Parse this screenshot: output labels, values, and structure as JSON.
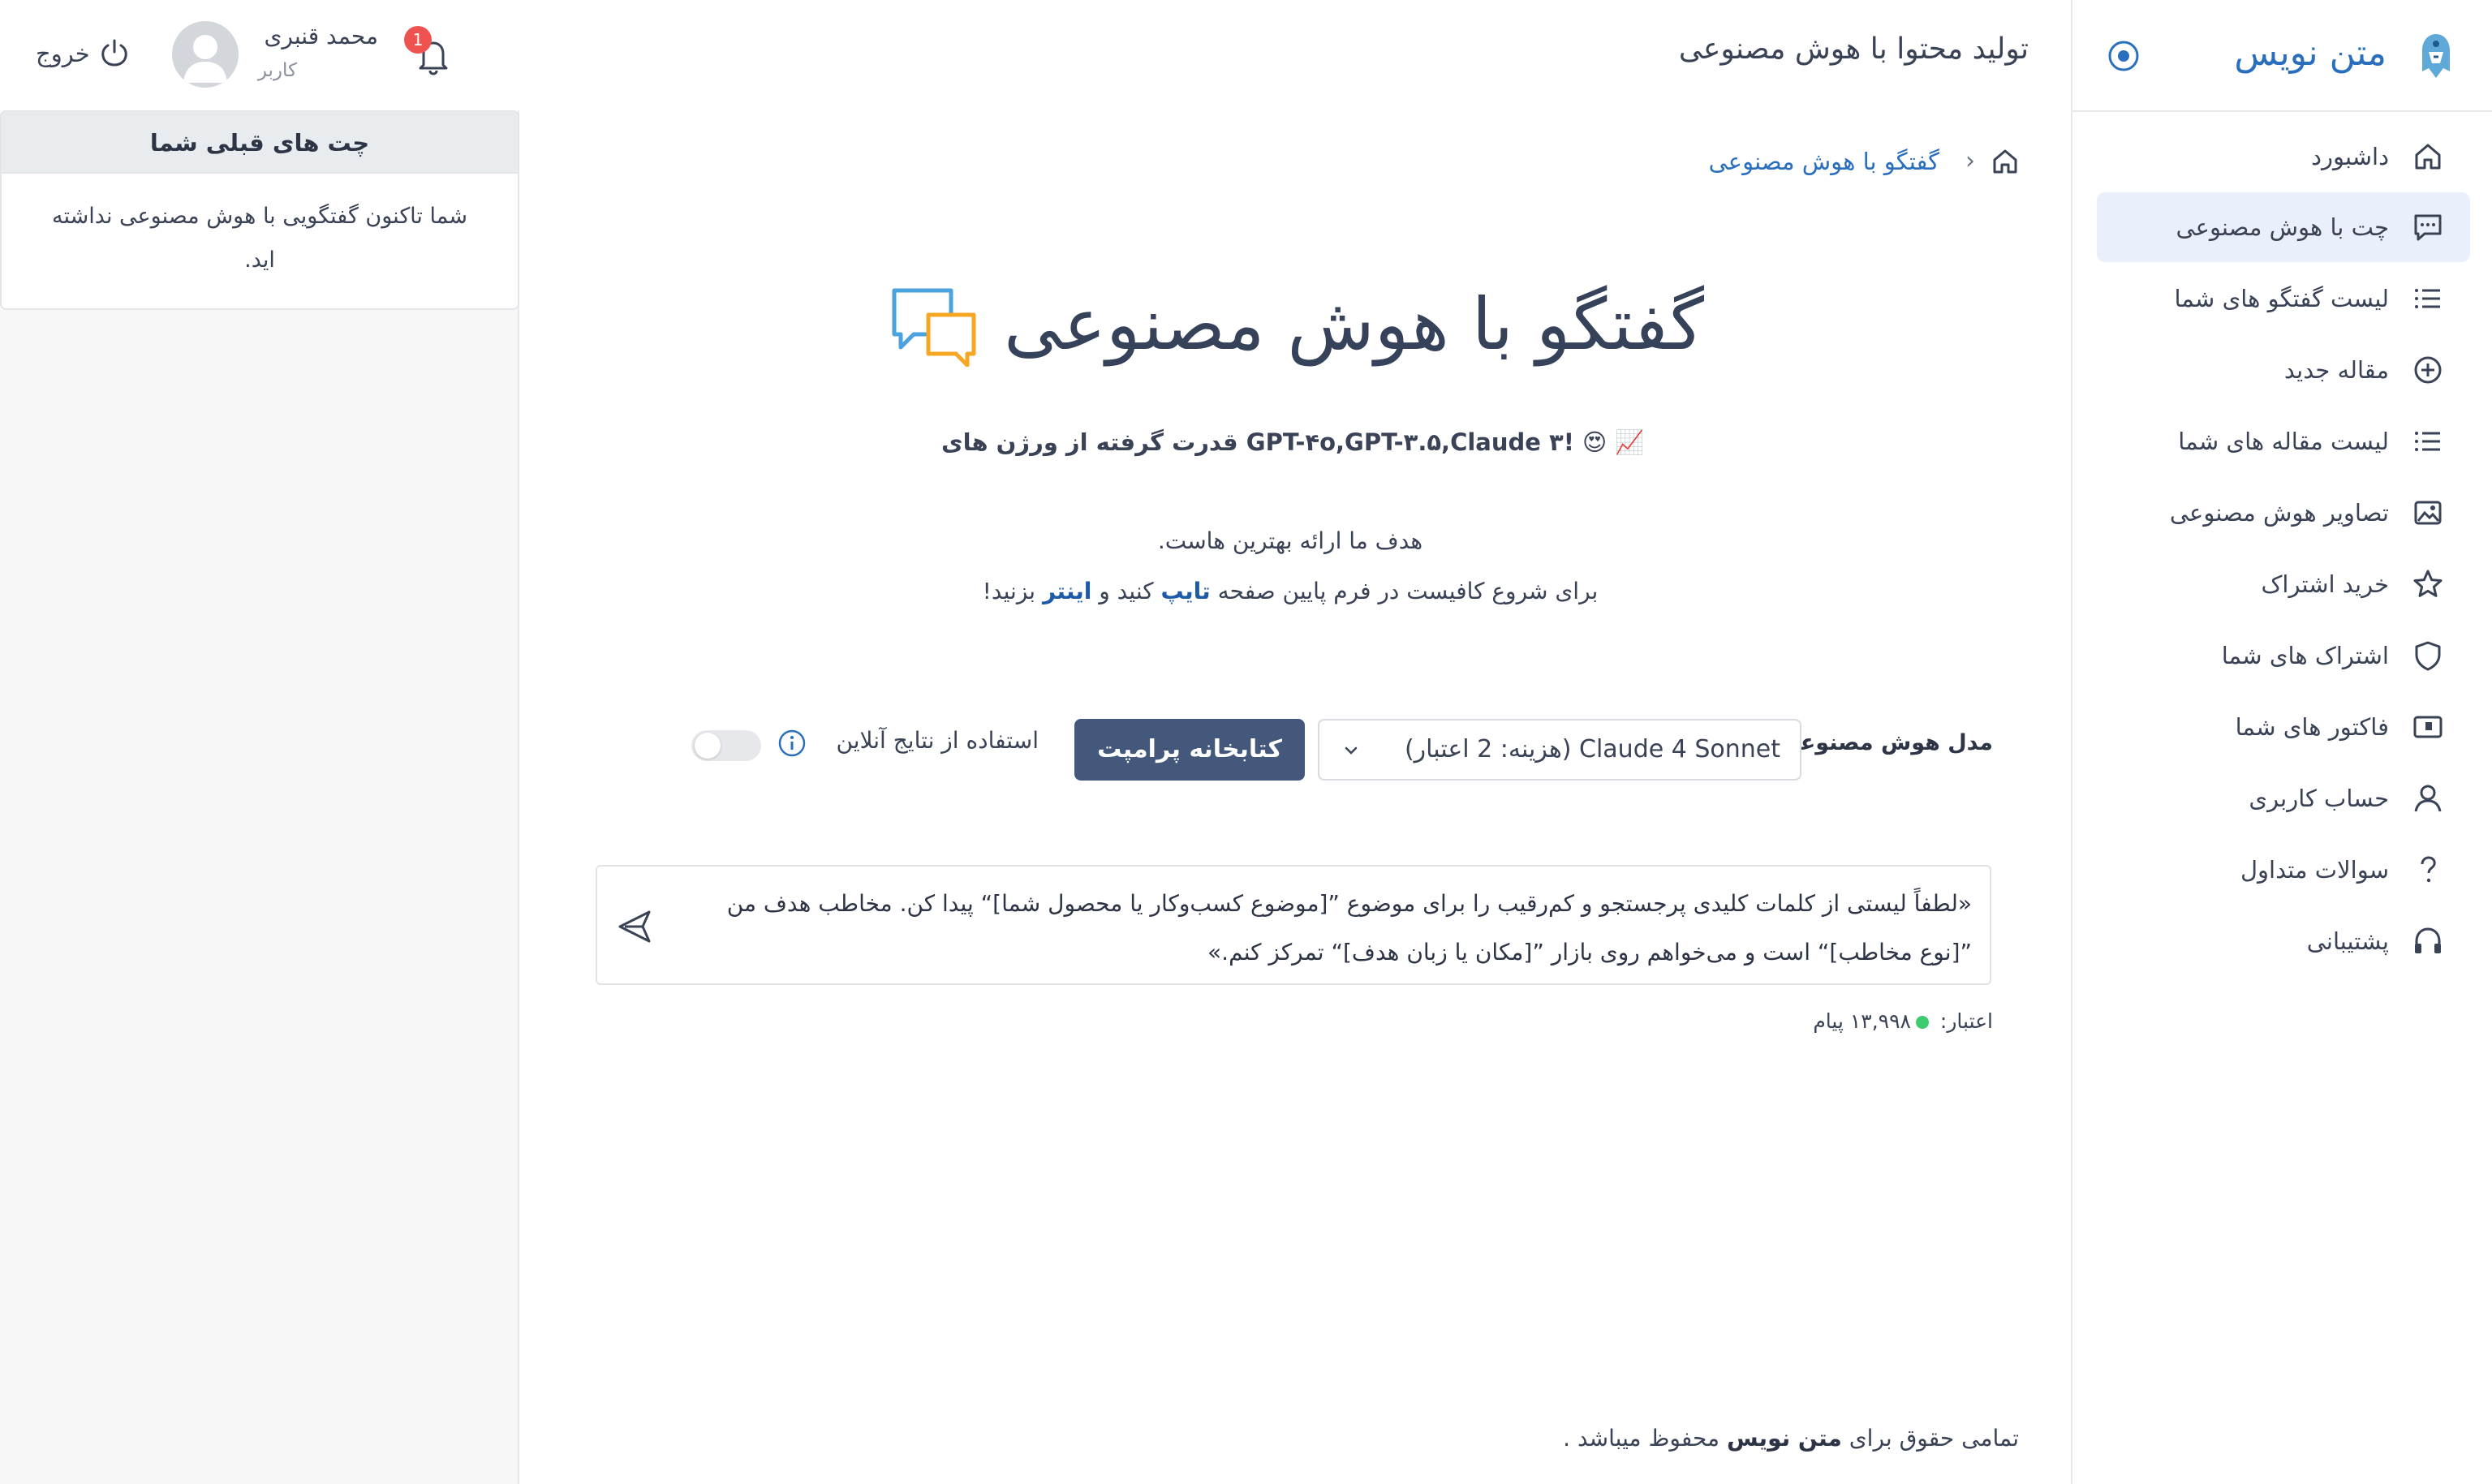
{
  "sidebar": {
    "brand": "متن نویس",
    "items": [
      {
        "label": "داشبورد",
        "icon": "home-icon",
        "active": false
      },
      {
        "label": "چت با هوش مصنوعی",
        "icon": "chat-icon",
        "active": true
      },
      {
        "label": "لیست گفتگو های شما",
        "icon": "list-icon",
        "active": false
      },
      {
        "label": "مقاله جدید",
        "icon": "plus-circle-icon",
        "active": false
      },
      {
        "label": "لیست مقاله های شما",
        "icon": "list-icon",
        "active": false
      },
      {
        "label": "تصاویر هوش مصنوعی",
        "icon": "image-icon",
        "active": false
      },
      {
        "label": "خرید اشتراک",
        "icon": "star-icon",
        "active": false
      },
      {
        "label": "اشتراک های شما",
        "icon": "shield-icon",
        "active": false
      },
      {
        "label": "فاکتور های شما",
        "icon": "invoice-icon",
        "active": false
      },
      {
        "label": "حساب کاربری",
        "icon": "user-icon",
        "active": false
      },
      {
        "label": "سوالات متداول",
        "icon": "question-icon",
        "active": false
      },
      {
        "label": "پشتیبانی",
        "icon": "headphones-icon",
        "active": false
      }
    ]
  },
  "header": {
    "title": "تولید محتوا با هوش مصنوعی",
    "user_name": "محمد قنبری",
    "user_role": "کاربر",
    "logout": "خروج",
    "notification_count": "1"
  },
  "previous_chats": {
    "title": "چت های قبلی شما",
    "empty_text": "شما تاکنون گفتگویی با هوش مصنوعی نداشته اید."
  },
  "breadcrumb": {
    "current": "گفتگو با هوش مصنوعی"
  },
  "main": {
    "hero_title": "گفتگو با هوش مصنوعی",
    "subtitle": "قدرت گرفته از ورژن های GPT-۴o,GPT-۳.۵,Claude ۳! 😍 📈",
    "desc1": "هدف ما ارائه بهترین هاست.",
    "desc2_pre": "برای شروع کافیست در فرم پایین صفحه ",
    "desc2_type": "تایپ",
    "desc2_mid": " کنید و ",
    "desc2_enter": "اینتر",
    "desc2_post": " بزنید!",
    "model_label": "مدل هوش مصنوعی",
    "model_selected": "Claude 4 Sonnet (هزینه: 2 اعتبار)",
    "prompt_library": "کتابخانه پرامپت",
    "online_results": "استفاده از نتایج آنلاین",
    "online_enabled": false,
    "message": "«لطفاً لیستی از کلمات کلیدی پرجستجو و کم‌رقیب را برای موضوع ”[موضوع کسب‌وکار یا محصول شما]“ پیدا کن. مخاطب هدف من ”[نوع مخاطب]“ است و می‌خواهم روی بازار ”[مکان یا زبان هدف]“ تمرکز کنم.»",
    "credit_label": "اعتبار:",
    "credit_value": "۱۳,۹۹۸ پیام"
  },
  "footer": {
    "pre": "تمامی حقوق برای ",
    "brand": "متن نویس",
    "post": " محفوظ میباشد ."
  },
  "colors": {
    "accent": "#2a6fbd",
    "button": "#43587a",
    "active_bg": "#e9f0fb",
    "badge": "#ef5350",
    "online_dot": "#3ccb6f"
  }
}
